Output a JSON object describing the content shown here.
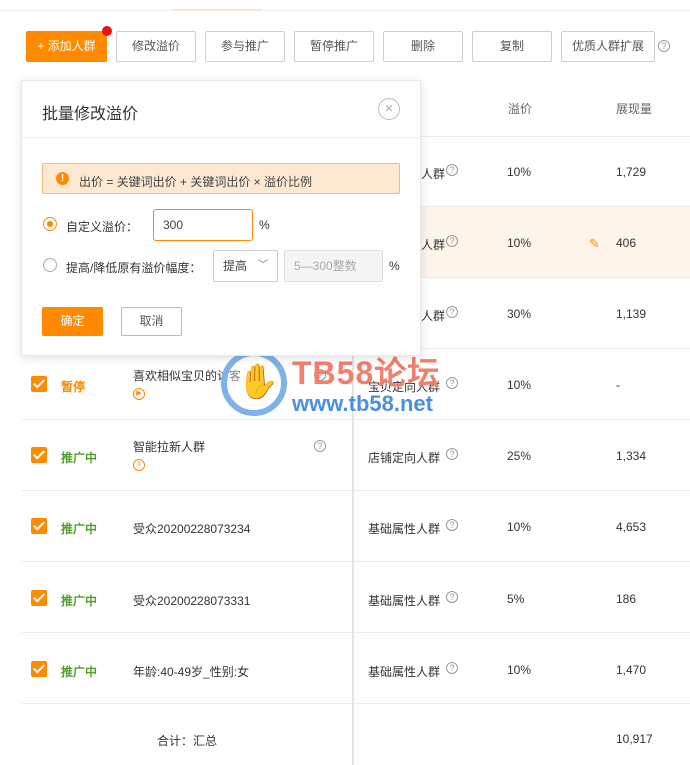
{
  "toolbar": {
    "add_label": "+ 添加人群",
    "modify_label": "修改溢价",
    "join_label": "参与推广",
    "pause_label": "暂停推广",
    "delete_label": "删除",
    "copy_label": "复制",
    "expand_label": "优质人群扩展"
  },
  "table": {
    "headers": {
      "premium": "溢价",
      "impressions": "展现量"
    },
    "rows": [
      {
        "type": "人群",
        "premium": "10%",
        "impressions": "1,729"
      },
      {
        "type": "人群",
        "premium": "10%",
        "impressions": "406"
      },
      {
        "type": "人群",
        "premium": "30%",
        "impressions": "1,139"
      },
      {
        "status": "暂停",
        "name": "喜欢相似宝贝的访客",
        "type": "宝贝定向人群",
        "premium": "10%",
        "impressions": "-"
      },
      {
        "status": "推广中",
        "name": "智能拉新人群",
        "type": "店铺定向人群",
        "premium": "25%",
        "impressions": "1,334"
      },
      {
        "status": "推广中",
        "name": "受众20200228073234",
        "type": "基础属性人群",
        "premium": "10%",
        "impressions": "4,653"
      },
      {
        "status": "推广中",
        "name": "受众20200228073331",
        "type": "基础属性人群",
        "premium": "5%",
        "impressions": "186"
      },
      {
        "status": "推广中",
        "name": "年龄:40-49岁_性别:女",
        "type": "基础属性人群",
        "premium": "10%",
        "impressions": "1,470"
      }
    ],
    "total_label": "合计：汇总",
    "total_impressions": "10,917"
  },
  "popup": {
    "title": "批量修改溢价",
    "close": "×",
    "formula": "出价 = 关键词出价 + 关键词出价 × 溢价比例",
    "custom_label": "自定义溢价：",
    "custom_value": "300",
    "percent": "%",
    "adjust_label": "提高/降低原有溢价幅度：",
    "adjust_select": "提高",
    "adjust_placeholder": "5—300整数",
    "ok_label": "确定",
    "cancel_label": "取消"
  },
  "watermark": {
    "title": "TB58论坛",
    "url": "www.tb58.net"
  },
  "colors": {
    "accent": "#ff8a00",
    "active": "#52a02a",
    "highlight_row": "#fdf4ea"
  }
}
